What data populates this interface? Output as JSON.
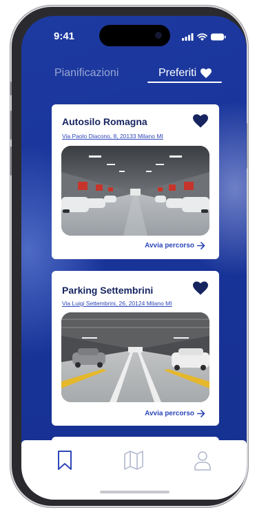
{
  "status_bar": {
    "time": "9:41"
  },
  "tabs": [
    {
      "label": "Pianificazioni",
      "active": false
    },
    {
      "label": "Preferiti",
      "active": true,
      "icon": "heart-icon"
    }
  ],
  "favorites": [
    {
      "name": "Autosilo Romagna",
      "address": "Via Paolo Diacono, 8, 20133 Milano MI",
      "action": "Avvia percorso",
      "favorited": true,
      "photo": "parking-garage-interior"
    },
    {
      "name": "Parking Settembrini",
      "address": "Via Luigi Settembrini, 26, 20124 Milano MI",
      "action": "Avvia percorso",
      "favorited": true,
      "photo": "parking-garage-interior"
    }
  ],
  "bottom_nav": [
    {
      "name": "bookmark-icon",
      "active": true
    },
    {
      "name": "map-icon",
      "active": false
    },
    {
      "name": "user-icon",
      "active": false
    }
  ],
  "colors": {
    "background": "#19349a",
    "accent": "#2c45b8",
    "heart": "#16245f",
    "title": "#16245f",
    "inactive_nav": "#b9bfd3"
  }
}
